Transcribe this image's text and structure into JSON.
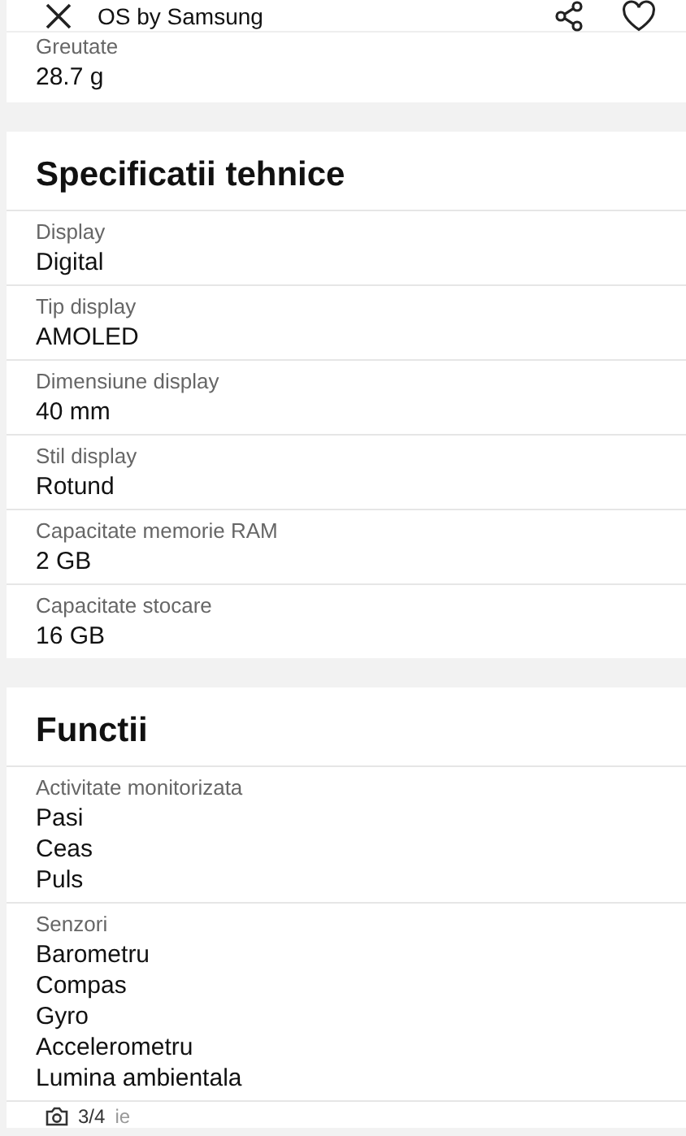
{
  "top_bar": {
    "title": "OS by Samsung"
  },
  "weight": {
    "label": "Greutate",
    "value": "28.7 g"
  },
  "sections": [
    {
      "title": "Specificatii tehnice",
      "rows": [
        {
          "label": "Display",
          "values": [
            "Digital"
          ]
        },
        {
          "label": "Tip display",
          "values": [
            "AMOLED"
          ]
        },
        {
          "label": "Dimensiune display",
          "values": [
            "40 mm"
          ]
        },
        {
          "label": "Stil display",
          "values": [
            "Rotund"
          ]
        },
        {
          "label": "Capacitate memorie RAM",
          "values": [
            "2 GB"
          ]
        },
        {
          "label": "Capacitate stocare",
          "values": [
            "16 GB"
          ]
        }
      ]
    },
    {
      "title": "Functii",
      "rows": [
        {
          "label": "Activitate monitorizata",
          "values": [
            "Pasi",
            "Ceas",
            "Puls"
          ]
        },
        {
          "label": "Senzori",
          "values": [
            "Barometru",
            "Compas",
            "Gyro",
            "Accelerometru",
            "Lumina ambientala"
          ]
        }
      ]
    }
  ],
  "photo_counter": {
    "count": "3/4",
    "caption": "ie"
  }
}
